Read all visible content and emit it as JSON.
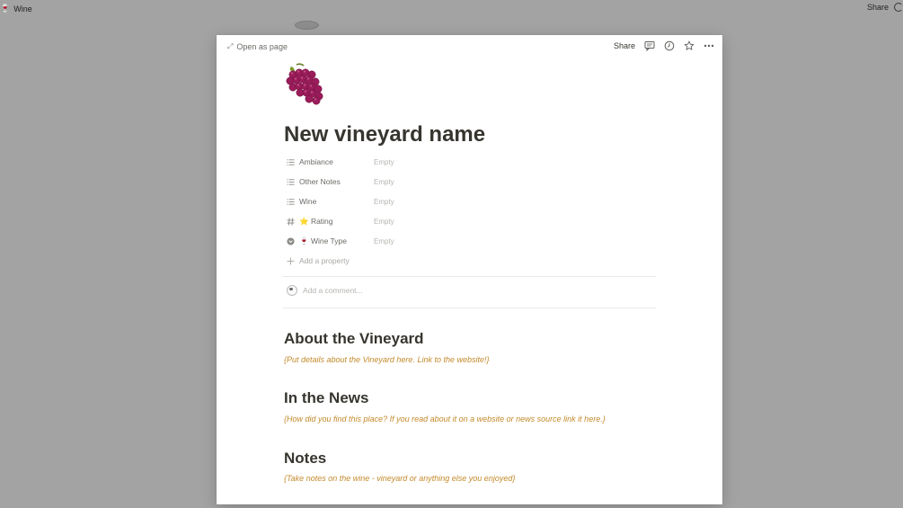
{
  "background": {
    "app_title": "Wine",
    "share_label": "Share"
  },
  "modal": {
    "open_as_page": "Open as page",
    "share_label": "Share"
  },
  "page": {
    "icon": "grapes-emoji",
    "title": "New vineyard name",
    "properties": [
      {
        "icon": "list-icon",
        "name": "Ambiance",
        "value": "Empty"
      },
      {
        "icon": "list-icon",
        "name": "Other Notes",
        "value": "Empty"
      },
      {
        "icon": "list-icon",
        "name": "Wine",
        "value": "Empty"
      },
      {
        "icon": "number-icon",
        "name": "⭐ Rating",
        "value": "Empty"
      },
      {
        "icon": "select-icon",
        "name": "🍷 Wine Type",
        "value": "Empty"
      }
    ],
    "add_property": "Add a property",
    "comment_placeholder": "Add a comment...",
    "sections": [
      {
        "heading": "About the Vineyard",
        "note": "{Put details about the Vineyard here.  Link to the website!}"
      },
      {
        "heading": "In the News",
        "note": "{How did you find this place?  If you read about it on a website or news source link it here.}"
      },
      {
        "heading": "Notes",
        "note": "{Take notes on the wine - vineyard or anything else you enjoyed}"
      }
    ]
  },
  "colors": {
    "note_accent": "#c38a2b",
    "overlay": "#a3a3a3",
    "text": "#37352f"
  }
}
